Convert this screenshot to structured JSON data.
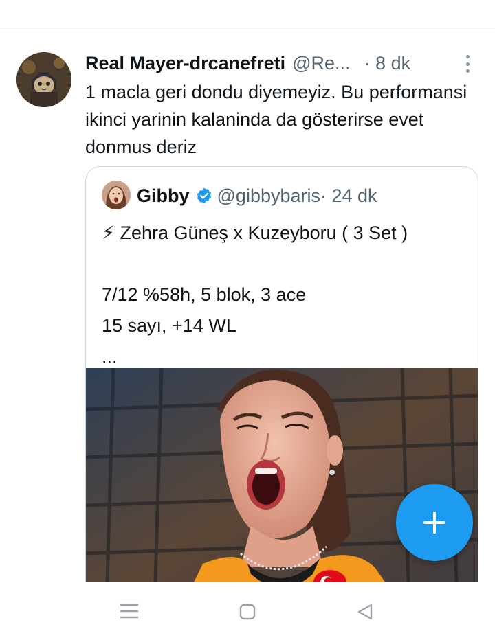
{
  "tweet": {
    "author_name": "Real Mayer-drcanefreti",
    "author_handle": "@Re...",
    "time": "· 8 dk",
    "text": "1 macla geri dondu diyemeyiz. Bu performansi ikinci yarinin kalaninda da gösterirse evet donmus deriz"
  },
  "quoted_tweet": {
    "author_name": "Gibby",
    "verified": true,
    "author_handle": "@gibbybaris",
    "time": " · 24 dk",
    "body": "⚡ Zehra Güneş x Kuzeyboru ( 3 Set )\n\n7/12 %58h, 5 blok, 3 ace\n15 sayı, +14 WL\n..."
  },
  "icons": {
    "more": "more-vertical-icon",
    "verified": "verified-badge-icon",
    "compose": "plus-icon",
    "nav_menu": "menu-icon",
    "nav_home": "home-square-icon",
    "nav_back": "back-triangle-icon"
  },
  "colors": {
    "accent": "#1d9bf0",
    "secondary_text": "#536471",
    "primary_text": "#0f1419",
    "border": "#cfd9de"
  }
}
